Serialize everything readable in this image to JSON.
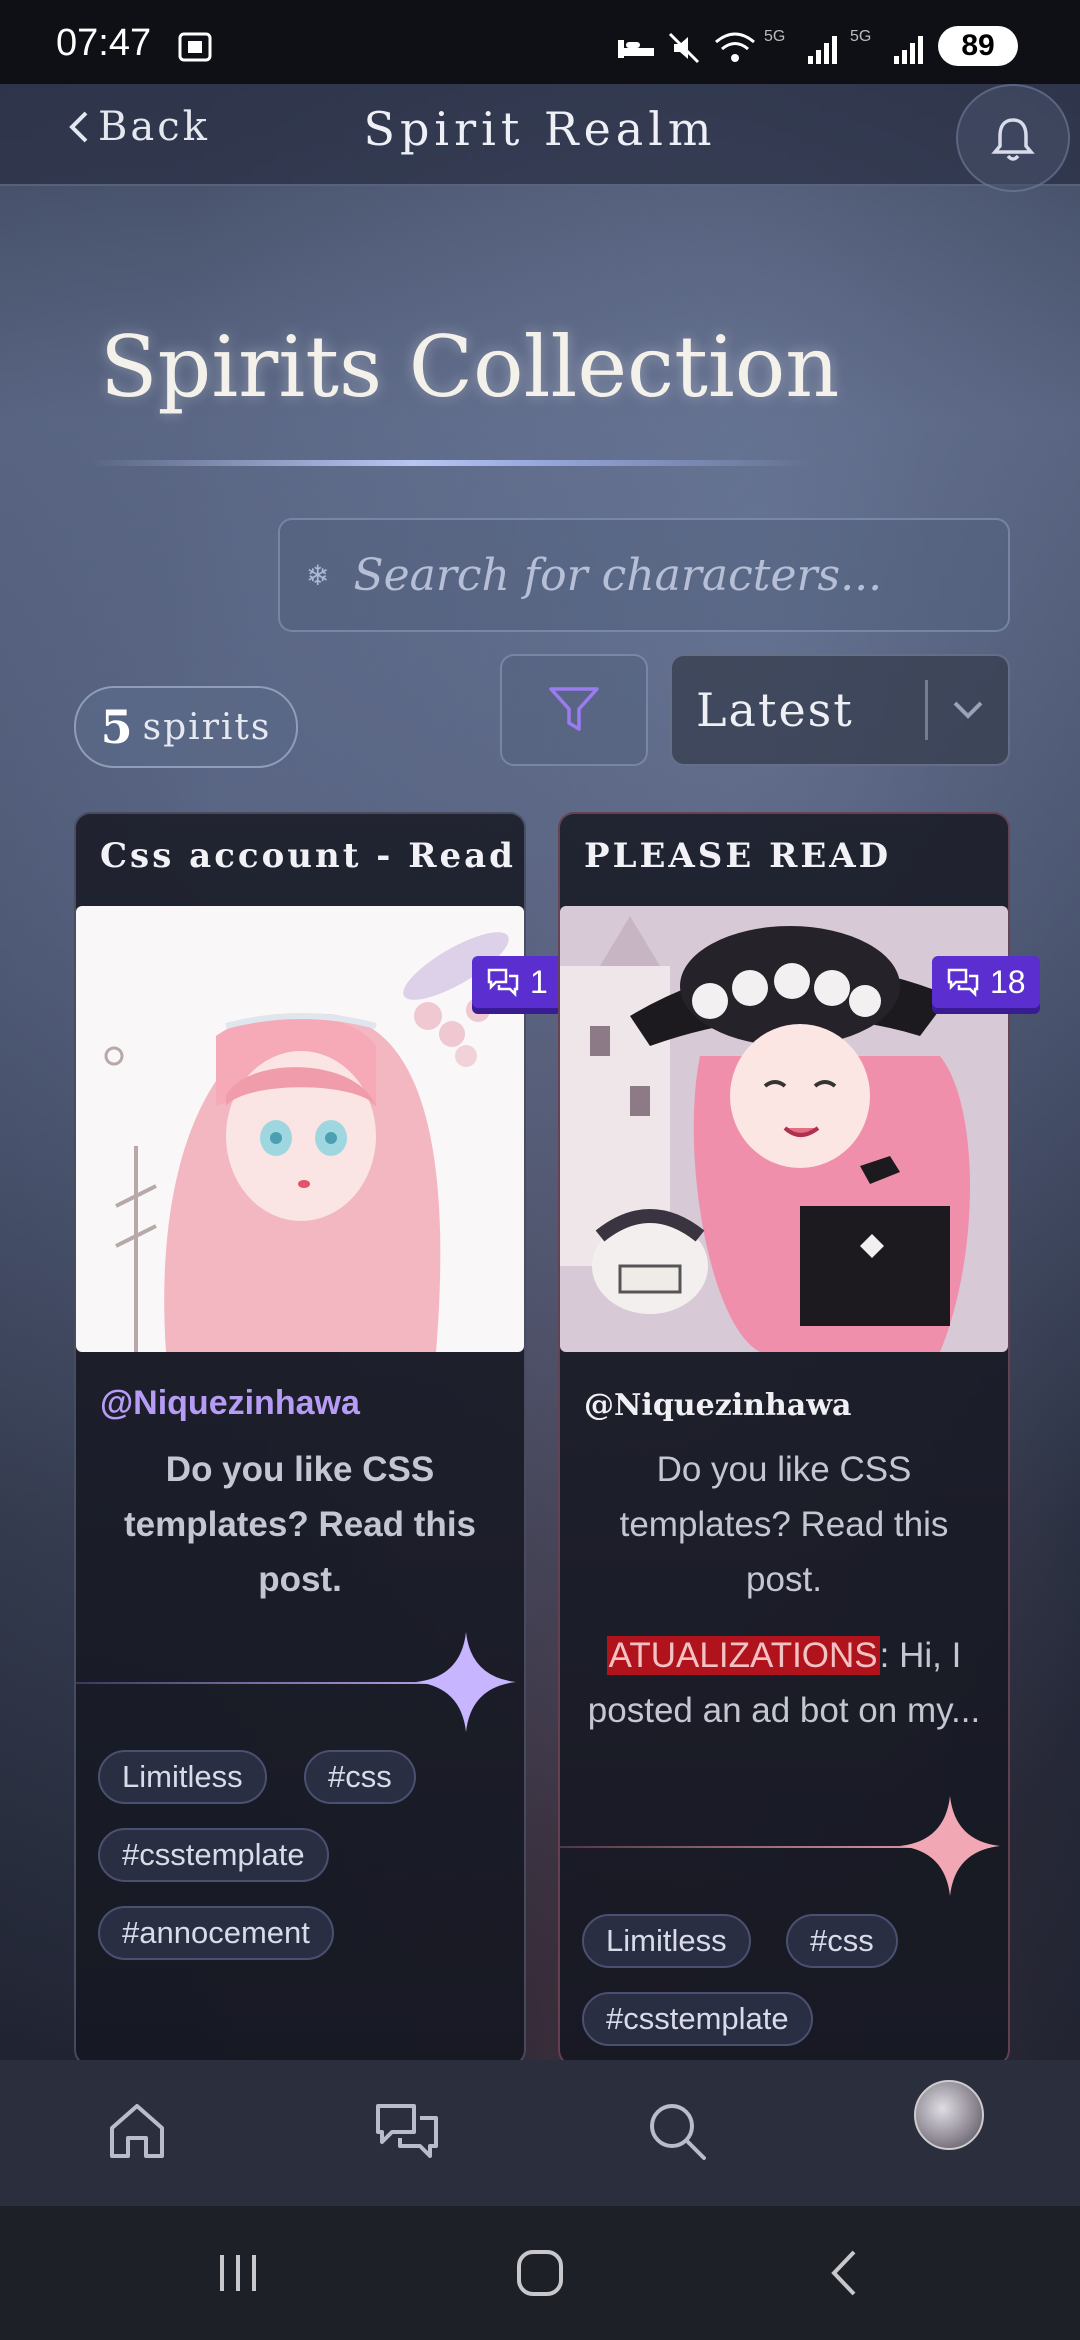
{
  "status_bar": {
    "time": "07:47",
    "network_1": "5G",
    "network_2": "5G",
    "battery": "89"
  },
  "header": {
    "back_label": "Back",
    "app_title": "Spirit Realm"
  },
  "page": {
    "title": "Spirits Collection"
  },
  "search": {
    "placeholder": "Search for characters..."
  },
  "summary": {
    "count": "5",
    "count_label": "spirits"
  },
  "sort": {
    "selected": "Latest"
  },
  "cards": [
    {
      "title": "Css account - Read",
      "comments": "1",
      "author": "@Niquezinhawa",
      "excerpt": "Do you like CSS templates? Read this post.",
      "tags": [
        "Limitless",
        "#css",
        "#csstemplate",
        "#annocement"
      ],
      "accent_color": "#c7b5ff"
    },
    {
      "title": "PLEASE READ",
      "comments": "18",
      "author": "@Niquezinhawa",
      "excerpt": "Do you like CSS templates? Read this post.",
      "highlight": "ATUALIZATIONS",
      "extra_text": ": Hi, I posted an ad bot on my...",
      "tags": [
        "Limitless",
        "#css",
        "#csstemplate"
      ],
      "accent_color": "#f1a8b4"
    }
  ],
  "bottom_nav": {
    "icons": [
      "home-icon",
      "chat-icon",
      "search-icon",
      "profile-avatar"
    ]
  },
  "colors": {
    "badge": "#5b2ed0",
    "author_link": "#b79cf5",
    "highlight": "#b0131b",
    "filter_icon": "#9b7cf0"
  }
}
